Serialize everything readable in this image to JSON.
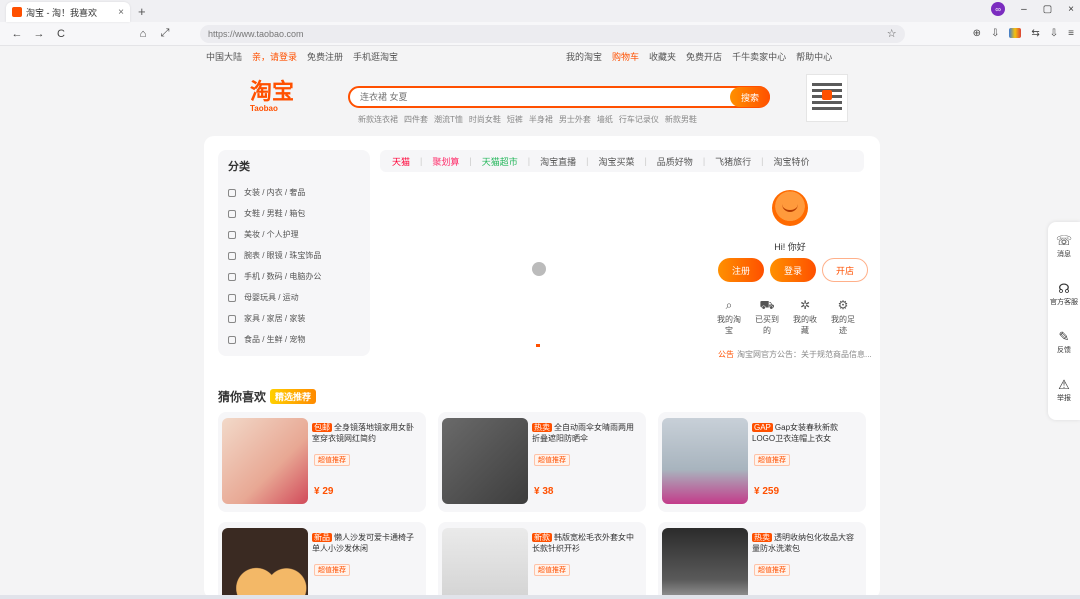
{
  "browser": {
    "tab_title": "淘宝 - 淘！我喜欢",
    "tab_close": "×",
    "new_tab": "+",
    "url": "https://www.taobao.com",
    "profile_icon": "∞",
    "window_controls": [
      "–",
      "▢",
      "×"
    ],
    "nav": {
      "back": "←",
      "forward": "→",
      "reload": "C",
      "home": "⌂",
      "expand": "⤢"
    },
    "star": "☆",
    "tools": [
      "⊕",
      "⇩",
      "⇩",
      "⇆",
      "≡"
    ]
  },
  "site_nav": {
    "left": [
      "中国大陆",
      "亲，请登录",
      "免费注册",
      "手机逛淘宝"
    ],
    "right": [
      "我的淘宝",
      "购物车",
      "收藏夹",
      "免费开店",
      "千牛卖家中心",
      "帮助中心"
    ]
  },
  "header": {
    "logo_big": "淘宝",
    "logo_small": "Taobao",
    "search_placeholder": "连衣裙 女夏",
    "search_button": "搜索",
    "hotwords": [
      "新款连衣裙",
      "四件套",
      "潮流T恤",
      "时尚女鞋",
      "短裤",
      "半身裙",
      "男士外套",
      "墙纸",
      "行车记录仪",
      "新款男鞋"
    ]
  },
  "categories": {
    "title": "分类",
    "items": [
      "女装 / 内衣 / 奢品",
      "女鞋 / 男鞋 / 箱包",
      "美妆 / 个人护理",
      "腕表 / 眼镜 / 珠宝饰品",
      "手机 / 数码 / 电脑办公",
      "母婴玩具 / 运动",
      "家具 / 家居 / 家装",
      "食品 / 生鲜 / 宠物"
    ]
  },
  "channels": [
    {
      "label": "天猫",
      "color": "red"
    },
    {
      "label": "聚划算",
      "color": "pink"
    },
    {
      "label": "天猫超市",
      "color": "green"
    },
    {
      "label": "淘宝直播",
      "color": ""
    },
    {
      "label": "淘宝买菜",
      "color": ""
    },
    {
      "label": "品质好物",
      "color": ""
    },
    {
      "label": "飞猪旅行",
      "color": ""
    },
    {
      "label": "淘宝特价",
      "color": ""
    }
  ],
  "user": {
    "name": "Hi! 你好",
    "buttons": [
      "注册",
      "登录",
      "开店"
    ],
    "shortcuts": [
      {
        "icon": "⌕",
        "label": "我的淘宝"
      },
      {
        "icon": "⛟",
        "label": "已买到的"
      },
      {
        "icon": "✲",
        "label": "我的收藏"
      },
      {
        "icon": "⚙",
        "label": "我的足迹"
      }
    ],
    "notice_tag": "公告",
    "notice": "淘宝网官方公告：关于规范商品信息..."
  },
  "recommend": {
    "title": "猜你喜欢",
    "badge": "精选推荐",
    "cards": [
      {
        "label": "包邮",
        "title": "全身镜落地镜家用女卧室穿衣镜网红简约",
        "tag": "超值推荐",
        "price": "¥ 29"
      },
      {
        "label": "热卖",
        "title": "全自动雨伞女晴雨两用折叠遮阳防晒伞",
        "tag": "超值推荐",
        "price": "¥ 38"
      },
      {
        "label": "GAP",
        "title": "Gap女装春秋新款LOGO卫衣连帽上衣女",
        "tag": "超值推荐",
        "price": "¥ 259"
      },
      {
        "label": "新品",
        "title": "懒人沙发可爱卡通椅子单人小沙发休闲",
        "tag": "超值推荐",
        "price": ""
      },
      {
        "label": "新款",
        "title": "韩版宽松毛衣外套女中长款针织开衫",
        "tag": "超值推荐",
        "price": ""
      },
      {
        "label": "热卖",
        "title": "透明收纳包化妆品大容量防水洗漱包",
        "tag": "超值推荐",
        "price": ""
      }
    ]
  },
  "sidebar": [
    {
      "icon": "☏",
      "label": "消息"
    },
    {
      "icon": "☊",
      "label": "官方客服"
    },
    {
      "icon": "✎",
      "label": "反馈"
    },
    {
      "icon": "⚠",
      "label": "举报"
    }
  ]
}
